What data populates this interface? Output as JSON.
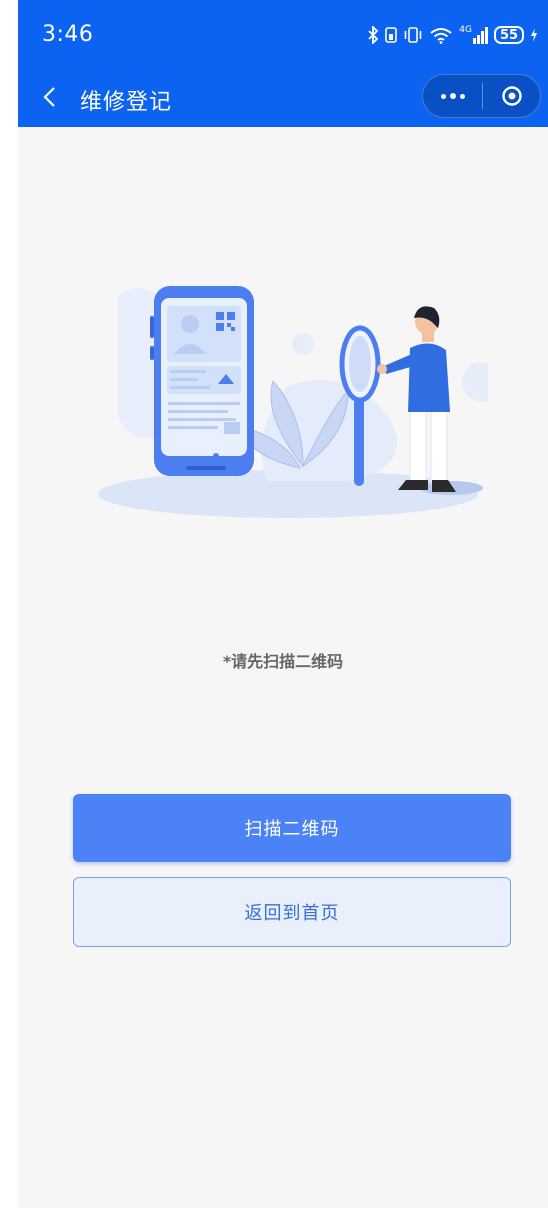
{
  "status_bar": {
    "time": "3:46",
    "signal_label": "4G",
    "battery": "55"
  },
  "navbar": {
    "title": "维修登记",
    "background": "#0c62f1"
  },
  "content": {
    "hint": "*请先扫描二维码",
    "scan_button": "扫描二维码",
    "home_button": "返回到首页"
  },
  "colors": {
    "primary_button": "#4b83f6",
    "secondary_button_bg": "#e9effb",
    "secondary_button_text": "#3a6fd8"
  },
  "icons": [
    "back-chevron-icon",
    "more-dots-icon",
    "close-target-icon",
    "bluetooth-icon",
    "vibrate-icon",
    "wifi-icon",
    "signal-icon",
    "battery-icon"
  ]
}
